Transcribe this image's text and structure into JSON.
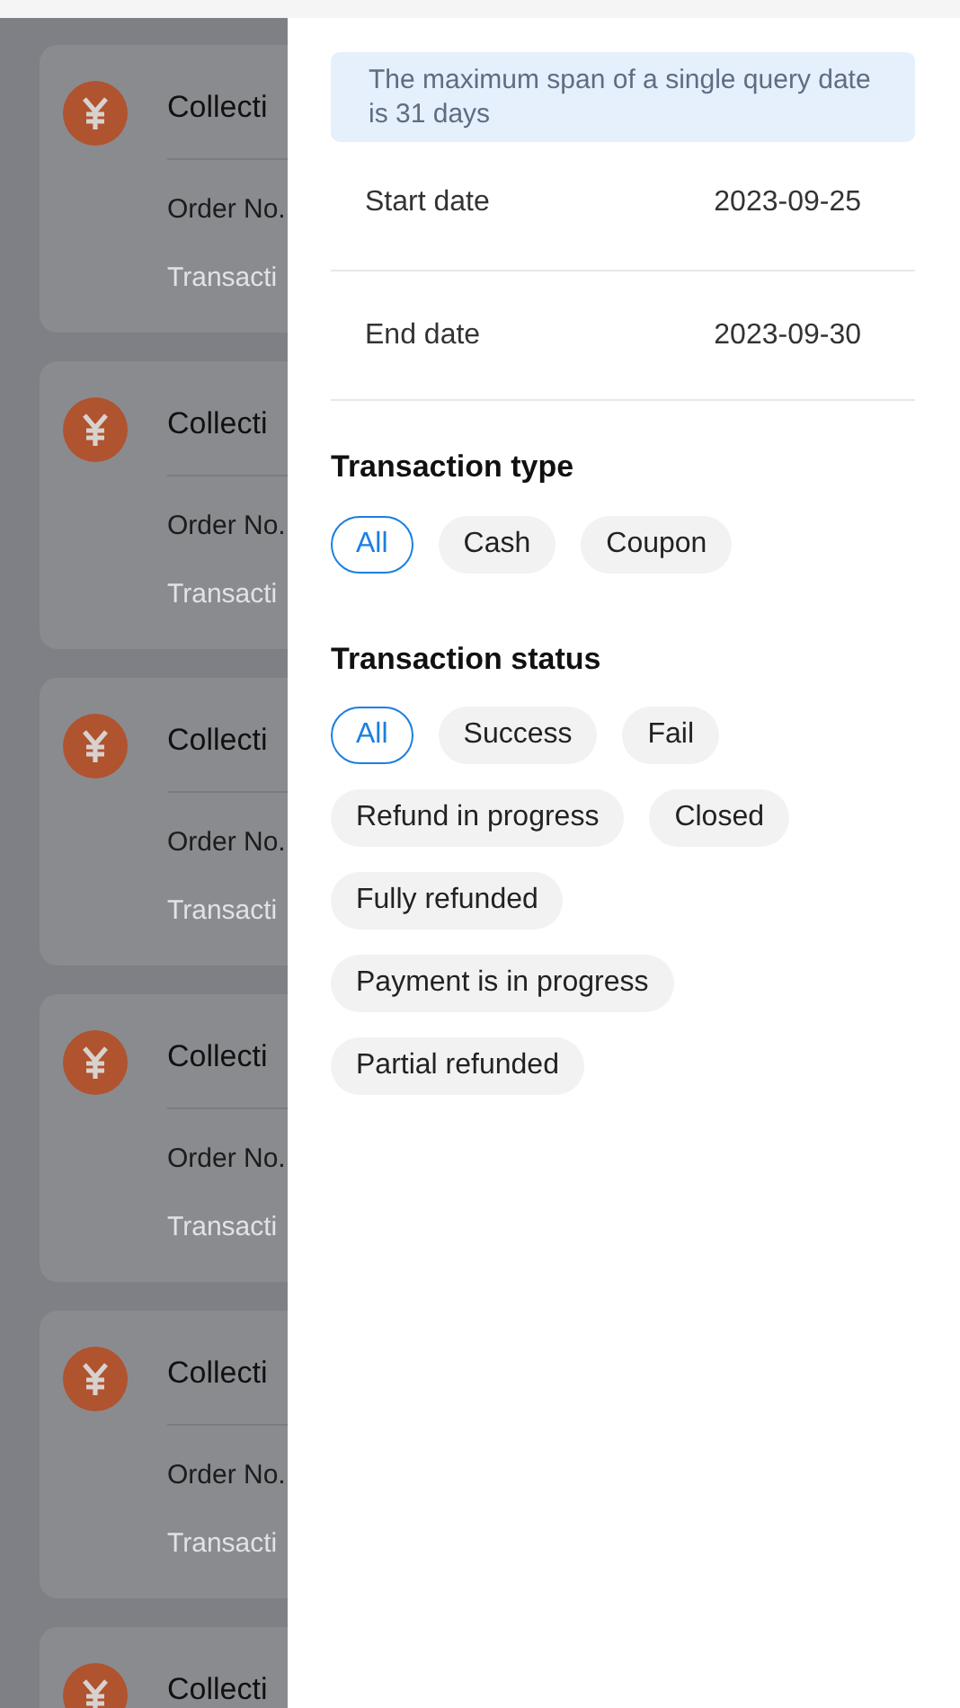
{
  "background_list": [
    {
      "title": "Collecti",
      "order": "Order No.",
      "transaction": "Transacti"
    },
    {
      "title": "Collecti",
      "order": "Order No.",
      "transaction": "Transacti"
    },
    {
      "title": "Collecti",
      "order": "Order No.",
      "transaction": "Transacti"
    },
    {
      "title": "Collecti",
      "order": "Order No.",
      "transaction": "Transacti"
    },
    {
      "title": "Collecti",
      "order": "Order No.",
      "transaction": "Transacti"
    },
    {
      "title": "Collecti"
    }
  ],
  "filter_panel": {
    "notice": "The maximum span of a single query date is 31 days",
    "dates": [
      {
        "label": "Start date",
        "value": "2023-09-25"
      },
      {
        "label": "End date",
        "value": "2023-09-30"
      }
    ],
    "sections": [
      {
        "title": "Transaction type",
        "options": [
          {
            "label": "All",
            "selected": true
          },
          {
            "label": "Cash",
            "selected": false
          },
          {
            "label": "Coupon",
            "selected": false
          }
        ]
      },
      {
        "title": "Transaction status",
        "options": [
          {
            "label": "All",
            "selected": true
          },
          {
            "label": "Success",
            "selected": false
          },
          {
            "label": "Fail",
            "selected": false
          },
          {
            "label": "Refund in progress",
            "selected": false
          },
          {
            "label": "Closed",
            "selected": false
          },
          {
            "label": "Fully refunded",
            "selected": false
          },
          {
            "label": "Payment is in progress",
            "selected": false
          },
          {
            "label": "Partial refunded",
            "selected": false
          }
        ]
      }
    ]
  }
}
